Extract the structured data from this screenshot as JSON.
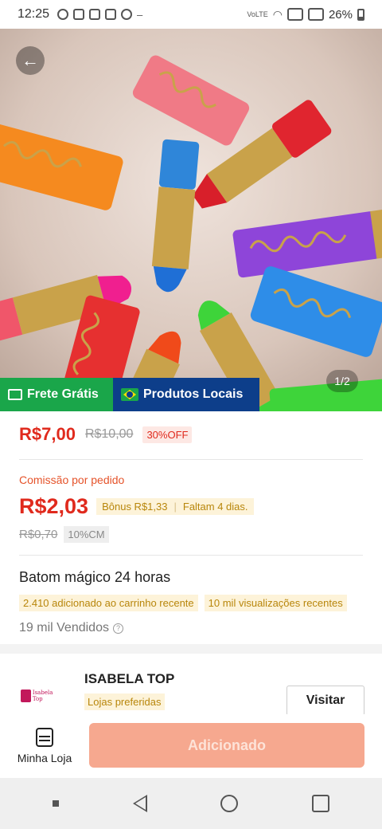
{
  "status_bar": {
    "time": "12:25",
    "battery": "26%",
    "network": "VoLTE"
  },
  "hero": {
    "page_indicator": "1/2",
    "back_icon": "arrow-left-icon"
  },
  "banners": {
    "frete": "Frete Grátis",
    "locais": "Produtos Locais"
  },
  "price": {
    "current": "R$7,00",
    "original": "R$10,00",
    "discount": "30%OFF"
  },
  "commission": {
    "label": "Comissão por pedido",
    "value": "R$2,03",
    "bonus": "Bônus R$1,33",
    "remaining": "Faltam 4 dias.",
    "old_value": "R$0,70",
    "rate": "10%CM"
  },
  "product": {
    "title": "Batom mágico 24 horas",
    "tag_cart": "2.410 adicionado ao carrinho recente",
    "tag_views": "10 mil visualizações recentes",
    "sold": "19 mil Vendidos"
  },
  "shop": {
    "logo_text": "Isabela Top",
    "name": "ISABELA TOP",
    "badge": "Lojas preferidas",
    "visit_label": "Visitar"
  },
  "bottom": {
    "store_label": "Minha Loja",
    "add_label": "Adicionado"
  },
  "colors": {
    "price_red": "#e02a1d",
    "frete_green": "#1aa64a",
    "locais_blue": "#0d3e8a",
    "add_button": "#f6a88f"
  }
}
